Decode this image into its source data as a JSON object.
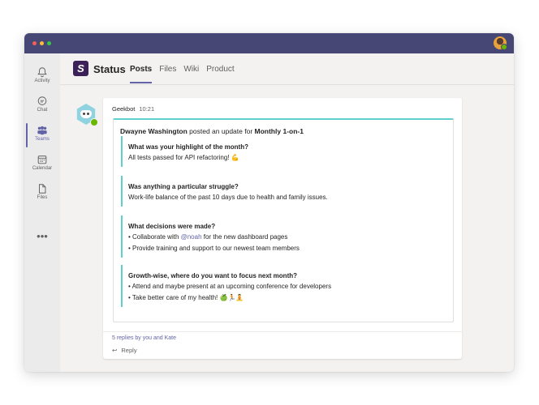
{
  "window": {
    "traffic_lights": [
      "close",
      "minimize",
      "maximize"
    ]
  },
  "rail": {
    "items": [
      {
        "label": "Activity",
        "icon": "bell-icon"
      },
      {
        "label": "Chat",
        "icon": "chat-icon"
      },
      {
        "label": "Teams",
        "icon": "teams-icon",
        "active": true
      },
      {
        "label": "Calendar",
        "icon": "calendar-icon"
      },
      {
        "label": "Files",
        "icon": "file-icon"
      }
    ],
    "more": "•••"
  },
  "header": {
    "app_logo": "S",
    "title": "Status",
    "tabs": [
      {
        "label": "Posts",
        "active": true
      },
      {
        "label": "Files"
      },
      {
        "label": "Wiki"
      },
      {
        "label": "Product"
      }
    ]
  },
  "post": {
    "author": "Geekbot",
    "time": "10:21",
    "card": {
      "user": "Dwayne Washington",
      "middle": " posted an update for ",
      "standup": "Monthly 1-on-1",
      "questions": [
        {
          "q": "What was your highlight of the month?",
          "lines": [
            "All tests passed for API refactoring! 💪"
          ]
        },
        {
          "q": "Was anything a particular struggle?",
          "lines": [
            "Work-life balance of the past 10 days due to health and family issues."
          ]
        },
        {
          "q": "What decisions were made?",
          "lines": [
            "• Collaborate with ",
            "• Provide training and support to our newest team members"
          ],
          "mention": "@noah",
          "mention_suffix": " for the new dashboard pages"
        },
        {
          "q": "Growth-wise, where do you want to focus next month?",
          "lines": [
            "• Attend and maybe present at an upcoming conference for developers",
            "• Take better care of my health! 🍏🏃🧘"
          ]
        }
      ]
    },
    "replies": "5 replies by you and Kate",
    "reply_label": "Reply",
    "reply_icon": "reply-arrow-icon"
  },
  "colors": {
    "titlebar": "#464775",
    "accent": "#6264a7",
    "card_accent": "#5fd0cc"
  }
}
